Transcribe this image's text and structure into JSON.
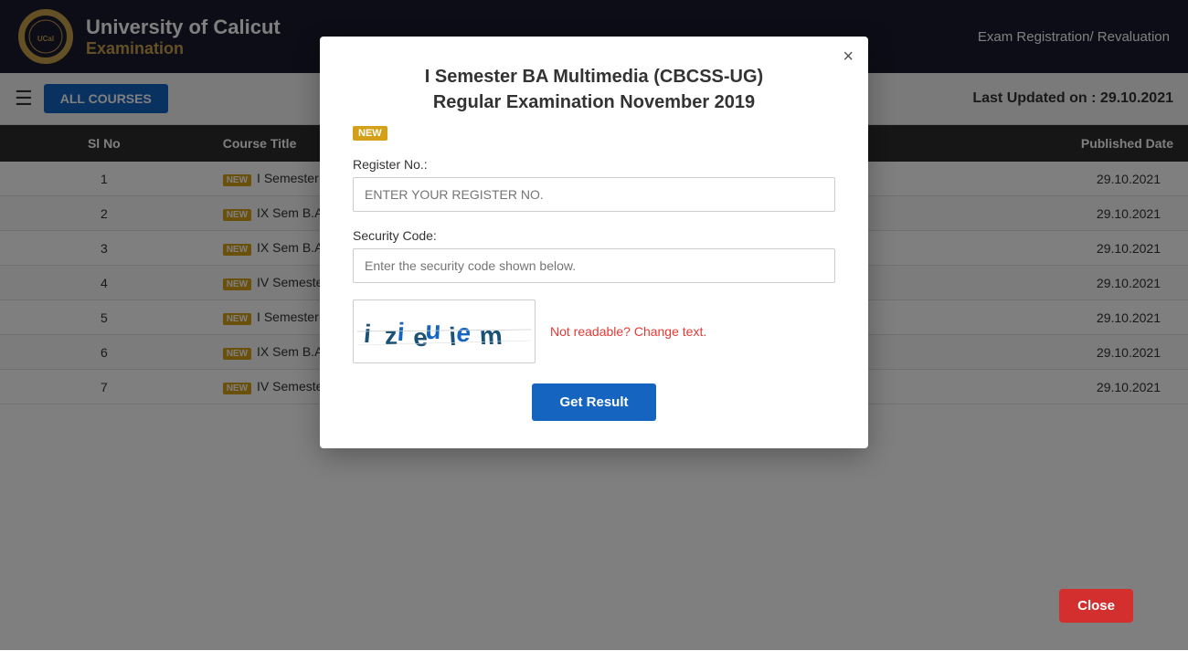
{
  "header": {
    "uni_name": "University of Calicut",
    "exam_label": "Examination",
    "nav_right": "Exam Registration/ Revaluation"
  },
  "toolbar": {
    "hamburger_label": "☰",
    "all_courses_label": "ALL COURSES",
    "last_updated": "Last Updated on : 29.10.2021"
  },
  "table": {
    "columns": [
      "Sl No",
      "Course Title",
      "Published Date"
    ],
    "rows": [
      {
        "sl": "1",
        "badge": "NEW",
        "title": "I Semester BA M...",
        "date": "29.10.2021"
      },
      {
        "sl": "2",
        "badge": "NEW",
        "title": "IX Sem B.Arch (...",
        "date": "29.10.2021"
      },
      {
        "sl": "3",
        "badge": "NEW",
        "title": "IX Sem B.Arch (...",
        "date": "29.10.2021"
      },
      {
        "sl": "4",
        "badge": "NEW",
        "title": "IV Semester M...",
        "date": "29.10.2021"
      },
      {
        "sl": "5",
        "badge": "NEW",
        "title": "I Semester BA (...",
        "date": "29.10.2021"
      },
      {
        "sl": "6",
        "badge": "NEW",
        "title": "IX Sem B.Arch (...",
        "date": "29.10.2021"
      },
      {
        "sl": "7",
        "badge": "NEW",
        "title": "IV Semester M...",
        "date": "29.10.2021"
      }
    ]
  },
  "modal": {
    "title_line1": "I Semester BA Multimedia (CBCSS-UG)",
    "title_line2": "Regular Examination November 2019",
    "new_badge": "NEW",
    "register_label": "Register No.:",
    "register_placeholder": "ENTER YOUR REGISTER NO.",
    "security_label": "Security Code:",
    "security_placeholder": "Enter the security code shown below.",
    "captcha_text": "izieuiem",
    "not_readable": "Not readable? Change text.",
    "get_result_label": "Get Result",
    "close_label": "Close",
    "close_icon": "×"
  }
}
